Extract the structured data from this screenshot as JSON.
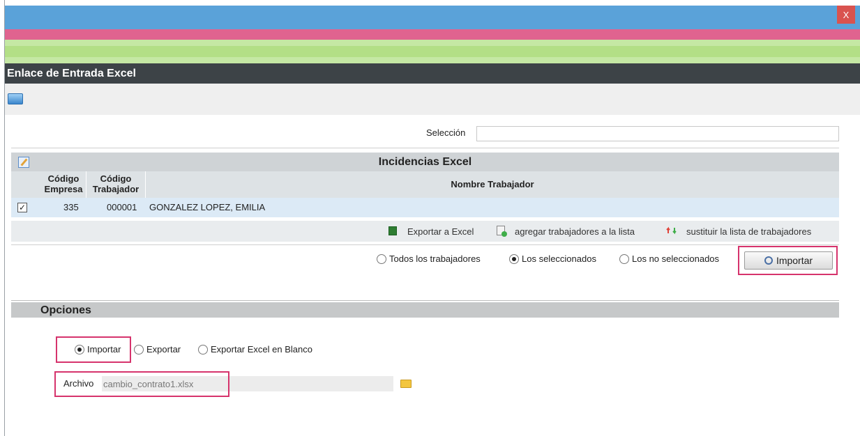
{
  "window": {
    "close_label": "X",
    "title": "Enlace de Entrada Excel"
  },
  "selection": {
    "label": "Selección",
    "value": ""
  },
  "panel": {
    "title": "Incidencias Excel"
  },
  "table": {
    "headers": {
      "empresa": "Código Empresa",
      "trabajador": "Código Trabajador",
      "nombre": "Nombre Trabajador"
    },
    "rows": [
      {
        "checked": "✓",
        "empresa": "335",
        "trabajador": "000001",
        "nombre": "GONZALEZ LOPEZ, EMILIA"
      }
    ]
  },
  "actions": {
    "export_excel": "Exportar a Excel",
    "add_workers": "agregar trabajadores a la lista",
    "replace_list": "sustituir la lista de trabajadores"
  },
  "filter": {
    "all": "Todos los trabajadores",
    "selected": "Los seleccionados",
    "not_selected": "Los no seleccionados",
    "value": "Los seleccionados"
  },
  "import_button": "Importar",
  "options": {
    "title": "Opciones",
    "importar": "Importar",
    "exportar": "Exportar",
    "exportar_blanco": "Exportar Excel en Blanco",
    "value": "Importar"
  },
  "archivo": {
    "label": "Archivo",
    "value": "cambio_contrato1.xlsx"
  },
  "colors": {
    "highlight": "#d6336c",
    "header_blue": "#5aa2d9",
    "stripe_pink": "#e0638f",
    "stripe_green": "#b3df86",
    "titlebar": "#3d4347"
  }
}
